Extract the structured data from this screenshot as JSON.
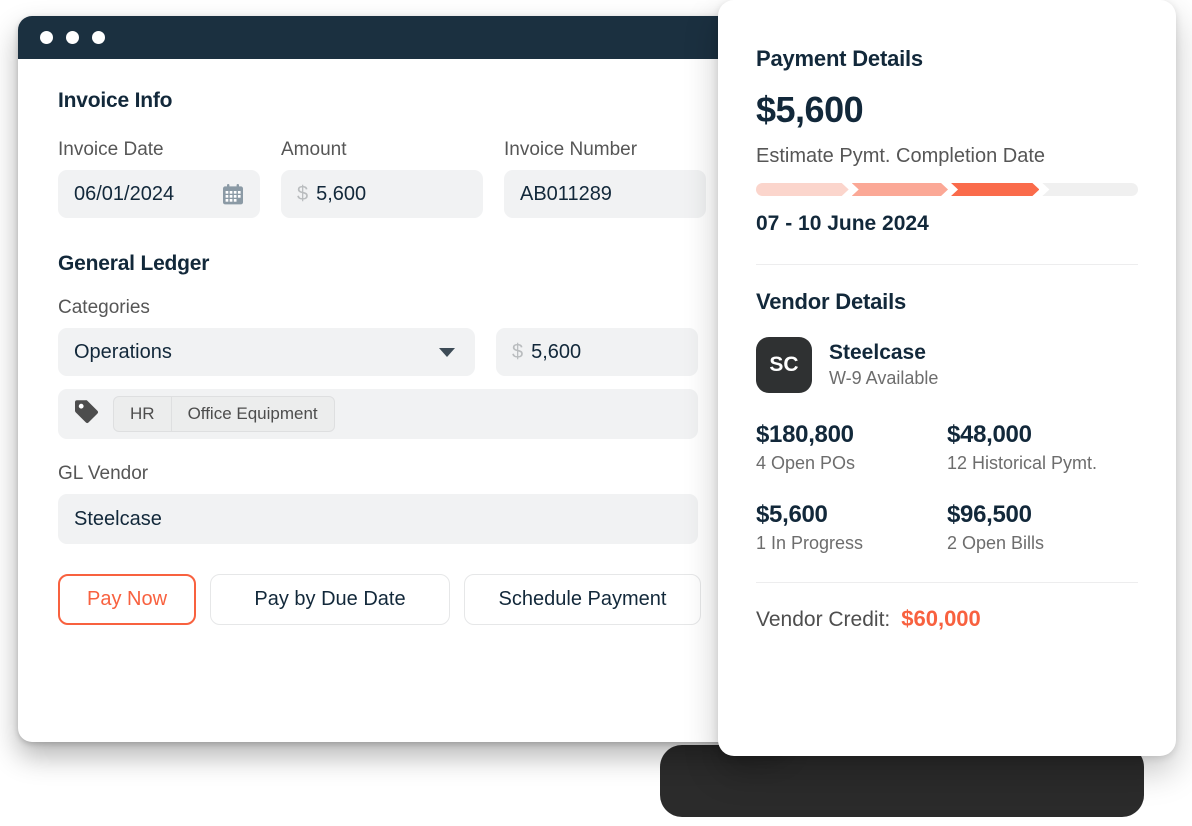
{
  "window": {
    "traffic_lights": [
      "close",
      "minimize",
      "maximize"
    ]
  },
  "invoice_info": {
    "title": "Invoice Info",
    "fields": [
      {
        "label": "Invoice Date",
        "value": "06/01/2024",
        "icon": "calendar-icon"
      },
      {
        "label": "Amount",
        "currency": "$",
        "value": "5,600"
      },
      {
        "label": "Invoice Number",
        "value": "AB011289"
      }
    ]
  },
  "general_ledger": {
    "title": "General Ledger",
    "categories_label": "Categories",
    "category_selected": "Operations",
    "category_amount_currency": "$",
    "category_amount": "5,600",
    "tags": [
      "HR",
      "Office Equipment"
    ],
    "tag_icon": "tag-icon",
    "gl_vendor_label": "GL Vendor",
    "gl_vendor_value": "Steelcase"
  },
  "actions": {
    "pay_now": "Pay Now",
    "pay_by_due_date": "Pay by Due Date",
    "schedule_payment": "Schedule Payment"
  },
  "payment_details": {
    "heading": "Payment Details",
    "amount": "$5,600",
    "estimate_label": "Estimate Pymt. Completion Date",
    "completion_date": "07 - 10 June 2024",
    "progress_segments": [
      {
        "color": "#fbd5cc"
      },
      {
        "color": "#fba896"
      },
      {
        "color": "#fa6b4b"
      },
      {
        "color": "#f0f0f0"
      }
    ]
  },
  "vendor_details": {
    "heading": "Vendor Details",
    "avatar_initials": "SC",
    "name": "Steelcase",
    "w9_status": "W-9 Available",
    "stats": [
      {
        "value": "$180,800",
        "label": "4 Open POs"
      },
      {
        "value": "$48,000",
        "label": "12 Historical Pymt."
      },
      {
        "value": "$5,600",
        "label": "1 In Progress"
      },
      {
        "value": "$96,500",
        "label": "2 Open Bills"
      }
    ],
    "credit_label": "Vendor Credit:",
    "credit_value": "$60,000"
  },
  "colors": {
    "accent": "#f8613f",
    "titlebar": "#1b3040",
    "dark_text": "#12283a",
    "field_bg": "#f1f2f3"
  }
}
